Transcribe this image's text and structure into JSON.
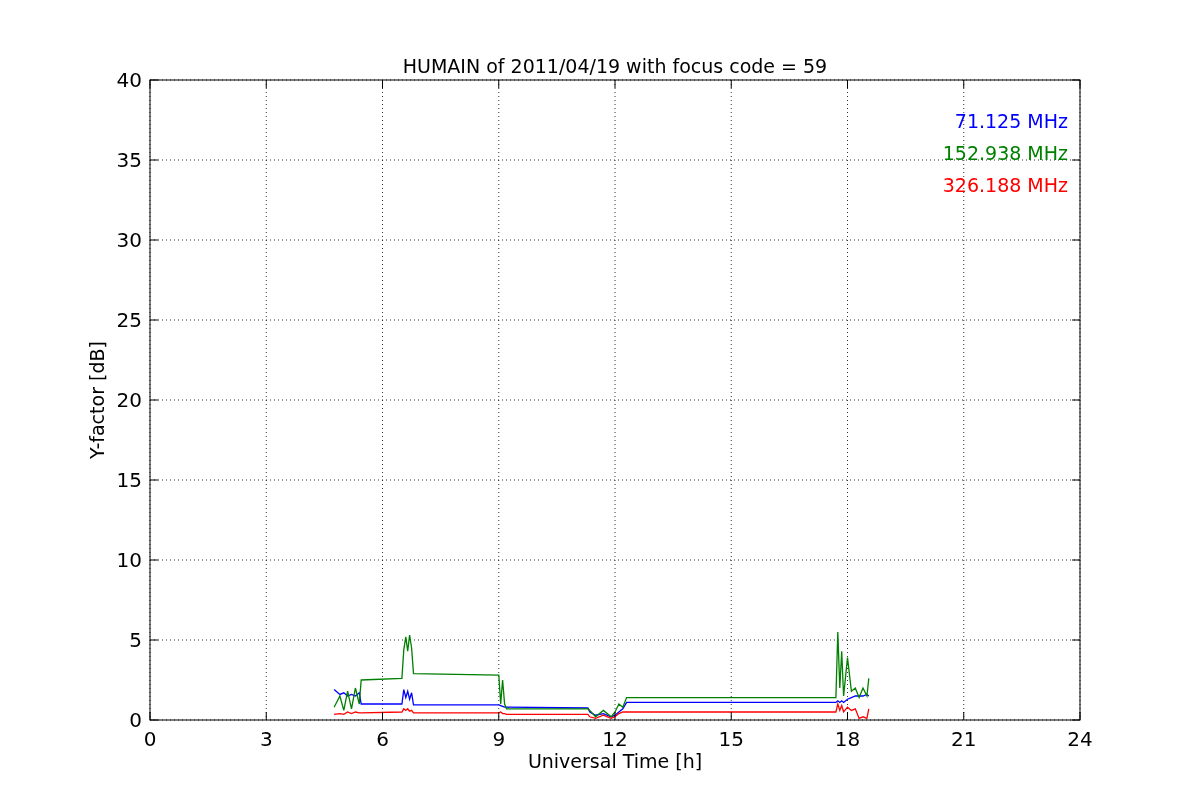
{
  "figure": {
    "chart_data": {
      "type": "line",
      "title": "HUMAIN of 2011/04/19 with focus code = 59",
      "xlabel": "Universal Time [h]",
      "ylabel": "Y-factor [dB]",
      "x": [
        4.75,
        4.9,
        5.0,
        5.1,
        5.2,
        5.3,
        5.4,
        5.45,
        6.5,
        6.55,
        6.6,
        6.65,
        6.7,
        6.75,
        6.8,
        9.0,
        9.05,
        9.1,
        9.15,
        9.2,
        11.3,
        11.35,
        11.5,
        11.7,
        11.9,
        12.0,
        12.1,
        12.2,
        12.3,
        17.7,
        17.75,
        17.8,
        17.85,
        17.9,
        18.0,
        18.1,
        18.2,
        18.3,
        18.4,
        18.5,
        18.55
      ],
      "series": [
        {
          "name": "71.125 MHz",
          "color": "#0000ff",
          "values": [
            1.9,
            1.6,
            1.7,
            1.5,
            1.6,
            1.5,
            1.7,
            1.0,
            1.0,
            1.9,
            1.4,
            1.8,
            1.3,
            1.7,
            0.95,
            0.95,
            0.9,
            0.85,
            0.8,
            0.8,
            0.75,
            0.5,
            0.3,
            0.4,
            0.2,
            0.3,
            0.5,
            0.7,
            1.1,
            1.1,
            1.2,
            1.1,
            1.2,
            1.1,
            1.3,
            1.4,
            1.5,
            1.5,
            1.5,
            1.6,
            1.5
          ]
        },
        {
          "name": "152.938 MHz",
          "color": "#008000",
          "values": [
            0.8,
            1.5,
            0.6,
            1.8,
            0.7,
            2.0,
            1.0,
            2.5,
            2.6,
            4.4,
            5.2,
            4.3,
            5.3,
            4.5,
            2.9,
            2.8,
            1.0,
            2.5,
            1.0,
            0.7,
            0.7,
            0.6,
            0.2,
            0.6,
            0.2,
            0.5,
            1.0,
            0.8,
            1.4,
            1.4,
            5.5,
            2.0,
            4.3,
            1.5,
            3.9,
            1.8,
            2.0,
            1.4,
            2.0,
            1.5,
            2.6
          ]
        },
        {
          "name": "326.188 MHz",
          "color": "#ff0000",
          "values": [
            0.35,
            0.4,
            0.35,
            0.5,
            0.4,
            0.5,
            0.45,
            0.45,
            0.5,
            0.7,
            0.6,
            0.7,
            0.55,
            0.6,
            0.45,
            0.45,
            0.5,
            0.4,
            0.4,
            0.35,
            0.35,
            0.2,
            0.1,
            0.3,
            0.1,
            0.2,
            0.4,
            0.5,
            0.5,
            0.5,
            1.0,
            0.6,
            0.9,
            0.5,
            0.8,
            0.6,
            0.7,
            0.1,
            0.2,
            0.1,
            0.7
          ]
        }
      ],
      "grid": true,
      "xlim": [
        0,
        24
      ],
      "ylim": [
        0,
        40
      ],
      "xticks": [
        0,
        3,
        6,
        9,
        12,
        15,
        18,
        21,
        24
      ],
      "yticks": [
        0,
        5,
        10,
        15,
        20,
        25,
        30,
        35,
        40
      ]
    }
  }
}
